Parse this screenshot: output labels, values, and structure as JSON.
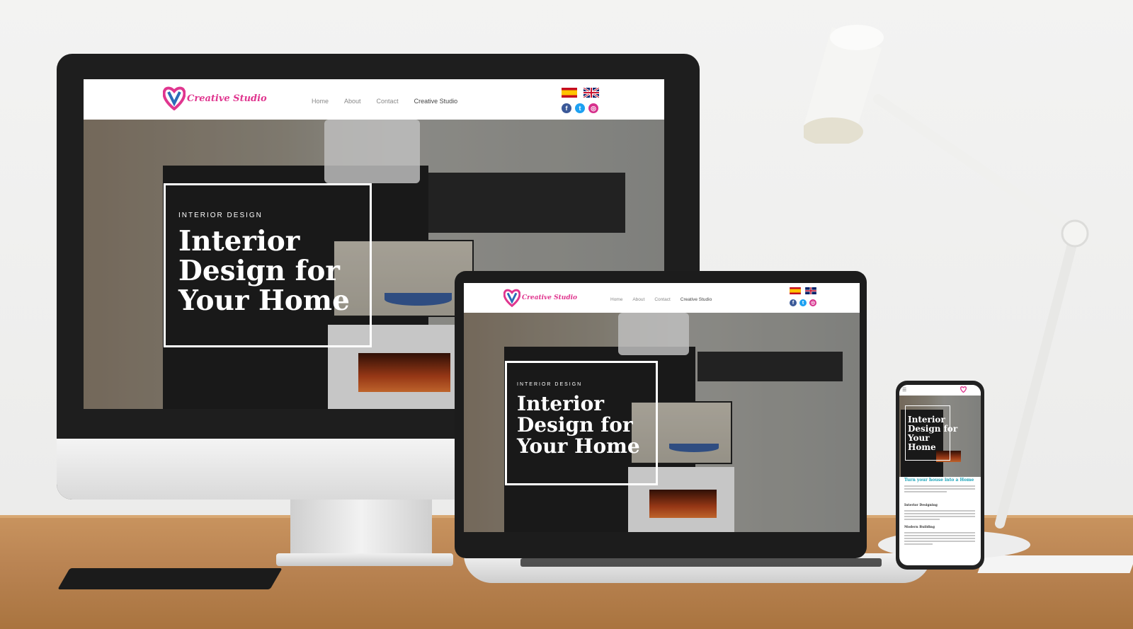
{
  "site": {
    "brand": "Creative Studio",
    "brand_colors": {
      "pink": "#e0368f",
      "blue": "#2b6cb8",
      "teal": "#1aa3b8"
    },
    "nav": [
      "Home",
      "About",
      "Contact",
      "Creative Studio"
    ],
    "languages": [
      {
        "code": "es",
        "icon": "spain-flag-icon"
      },
      {
        "code": "en",
        "icon": "uk-flag-icon"
      }
    ],
    "social": [
      {
        "icon": "facebook-icon",
        "glyph": "f",
        "color": "#3b5998"
      },
      {
        "icon": "twitter-icon",
        "glyph": "t",
        "color": "#1da1f2"
      },
      {
        "icon": "instagram-icon",
        "glyph": "◎",
        "color": "#d6308c"
      }
    ],
    "hero": {
      "overline": "INTERIOR DESIGN",
      "headline_line1": "Interior",
      "headline_line2": "Design for",
      "headline_line3": "Your Home",
      "phone_line1": "Interior",
      "phone_line2": "Design for",
      "phone_line3": "Your",
      "phone_line4": "Home"
    },
    "mobile": {
      "section_title": "Turn your house into a Home",
      "sub1": "Interior Designing",
      "sub2": "Modern Building"
    }
  }
}
